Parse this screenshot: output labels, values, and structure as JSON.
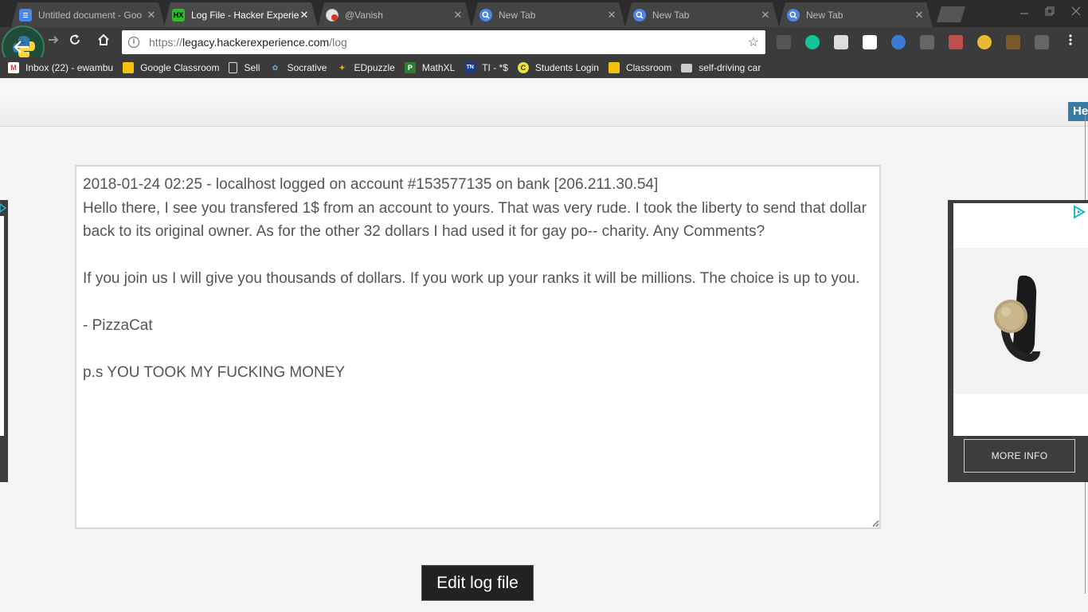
{
  "browser": {
    "tabs": [
      {
        "title": "Untitled document - Goo",
        "favicon": "docs-icon",
        "active": false
      },
      {
        "title": "Log File - Hacker Experie",
        "favicon": "hx-icon",
        "active": true
      },
      {
        "title": "@Vanish",
        "favicon": "vanish-icon",
        "active": false
      },
      {
        "title": "New Tab",
        "favicon": "search-icon",
        "active": false
      },
      {
        "title": "New Tab",
        "favicon": "search-icon",
        "active": false
      },
      {
        "title": "New Tab",
        "favicon": "search-icon",
        "active": false
      }
    ],
    "tab_close_glyph": "✕",
    "url": {
      "protocol": "https://",
      "host": "legacy.hackerexperience.com",
      "path": "/log"
    },
    "bookmarks": [
      {
        "label": "Inbox (22) - ewambu",
        "icon": "gmail-icon"
      },
      {
        "label": "Google Classroom",
        "icon": "classroom-icon"
      },
      {
        "label": "Sell",
        "icon": "page-icon"
      },
      {
        "label": "Socrative",
        "icon": "socrative-icon"
      },
      {
        "label": "EDpuzzle",
        "icon": "edpuzzle-icon"
      },
      {
        "label": "MathXL",
        "icon": "mathxl-icon"
      },
      {
        "label": "TI - *$",
        "icon": "ti-icon"
      },
      {
        "label": "Students Login",
        "icon": "students-login-icon"
      },
      {
        "label": "Classroom",
        "icon": "classroom-icon"
      },
      {
        "label": "self-driving car",
        "icon": "folder-icon"
      }
    ]
  },
  "page": {
    "header_badge": "He",
    "log_text": "2018-01-24 02:25 - localhost logged on account #153577135 on bank [206.211.30.54]\nHello there, I see you transfered 1$ from an account to yours. That was very rude. I took the liberty to send that dollar back to its original owner. As for the other 32 dollars I had used it for gay po-- charity. Any Comments?\n\nIf you join us I will give you thousands of dollars. If you work up your ranks it will be millions. The choice is up to you.\n\n- PizzaCat\n\np.s YOU TOOK MY FUCKING MONEY",
    "edit_button": "Edit log file",
    "ad": {
      "more_info": "MORE INFO"
    }
  },
  "colors": {
    "accent": "#3a7ca5",
    "chrome_dark": "#2b2b2b",
    "ad_arrow": "#1fb6c8"
  }
}
